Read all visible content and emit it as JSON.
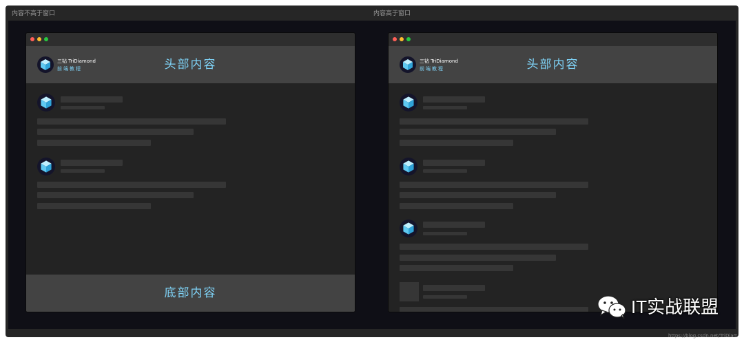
{
  "panes": {
    "left": {
      "label": "内容不高于窗口"
    },
    "right": {
      "label": "内容高于窗口"
    }
  },
  "header": {
    "brand_top": "三钻 TriDiamond",
    "brand_bottom": "前端教程",
    "title": "头部内容"
  },
  "footer": {
    "title": "底部内容"
  },
  "watermark": {
    "text": "IT实战联盟",
    "icon": "wechat-icon"
  },
  "url": "https://blog.csdn.net/TriDiamond",
  "colors": {
    "accent": "#7fd3f7",
    "header_bg": "#434343",
    "window_bg": "#232323",
    "skeleton": "#363636"
  }
}
